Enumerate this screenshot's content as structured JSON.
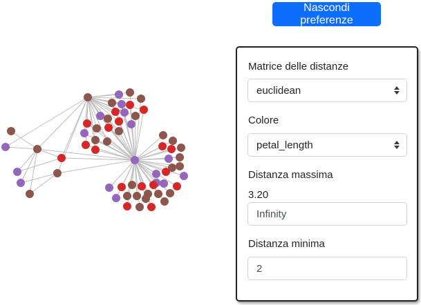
{
  "toolbar": {
    "toggle_label": "Nascondi preferenze"
  },
  "preferences": {
    "distance_matrix": {
      "label": "Matrice delle distanze",
      "value": "euclidean"
    },
    "color": {
      "label": "Colore",
      "value": "petal_length"
    },
    "max_distance": {
      "label": "Distanza massima",
      "current": "3.20",
      "value": "Infinity"
    },
    "min_distance": {
      "label": "Distanza minima",
      "value": "2"
    }
  },
  "graph": {
    "colors": {
      "purple": "#9467bd",
      "brown": "#8c564b",
      "red": "#d62728",
      "edge": "#bdbdbd"
    }
  }
}
